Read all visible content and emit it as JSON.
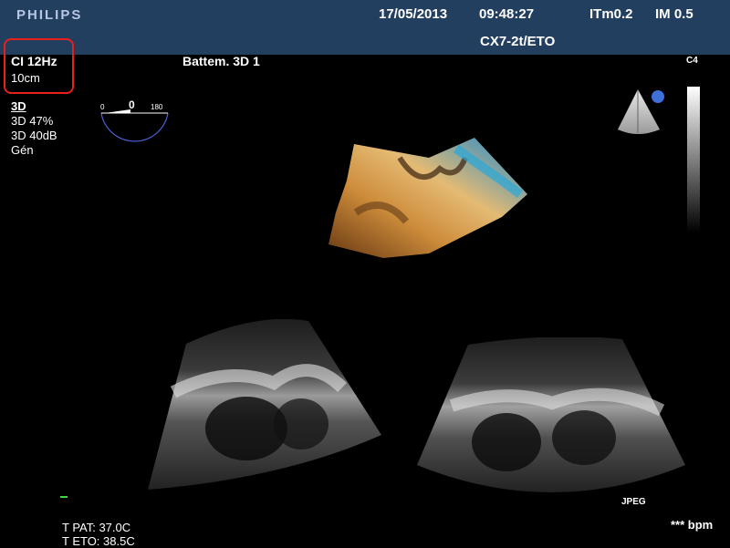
{
  "header": {
    "brand": "PHILIPS",
    "date": "17/05/2013",
    "time": "09:48:27",
    "itm": "ITm0.2",
    "mi": "IM 0.5",
    "probe": "CX7-2t/ETO"
  },
  "left_panel": {
    "rate": "CI 12Hz",
    "depth": "10cm",
    "mode": "3D",
    "gain": "3D 47%",
    "compress": "3D 40dB",
    "preset": "Gén"
  },
  "angle_indicator": {
    "min": "0",
    "value": "0",
    "max": "180"
  },
  "view_title": "Battem. 3D 1",
  "colormap_label": "C4",
  "jpeg_label": "JPEG",
  "bpm": "*** bpm",
  "temps": {
    "pat": "T PAT: 37.0C",
    "eto": "T ETO: 38.5C"
  },
  "colors": {
    "header_bg": "#233f60",
    "brand": "#b6c7e6",
    "highlight": "#e8201c",
    "probe_dot": "#3f6fd8",
    "arc": "#4a62d8"
  }
}
